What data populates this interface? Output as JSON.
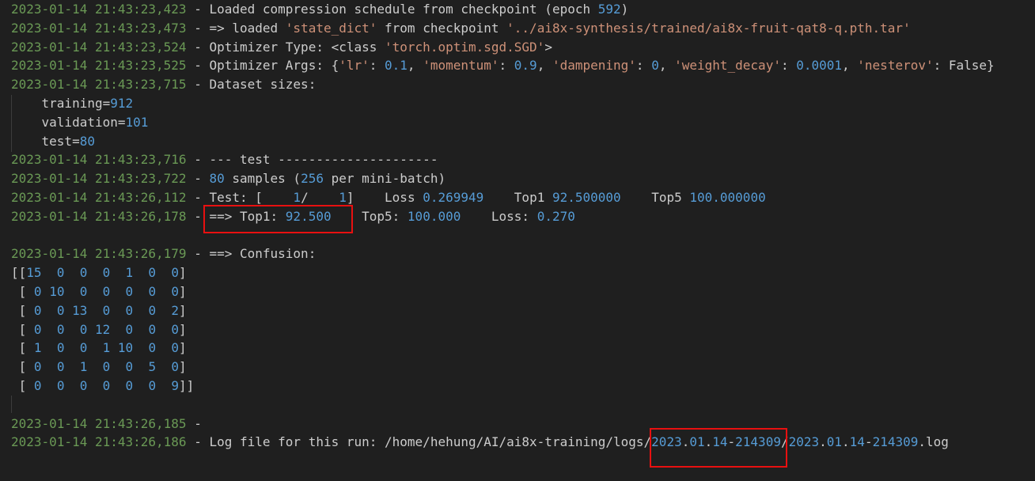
{
  "lines": [
    {
      "name": "log-line-1",
      "segs": [
        [
          "ts",
          "2023-01-14 21:43:23,423"
        ],
        [
          "txt",
          " - Loaded compression schedule from checkpoint (epoch "
        ],
        [
          "num",
          "592"
        ],
        [
          "txt",
          ")"
        ]
      ]
    },
    {
      "name": "log-line-2",
      "segs": [
        [
          "ts",
          "2023-01-14 21:43:23,473"
        ],
        [
          "txt",
          " - => loaded "
        ],
        [
          "str",
          "'state_dict'"
        ],
        [
          "txt",
          " from checkpoint "
        ],
        [
          "str",
          "'../ai8x-synthesis/trained/ai8x-fruit-qat8-q.pth.tar'"
        ]
      ]
    },
    {
      "name": "log-line-3",
      "segs": [
        [
          "ts",
          "2023-01-14 21:43:23,524"
        ],
        [
          "txt",
          " - Optimizer Type: <class "
        ],
        [
          "str",
          "'torch.optim.sgd.SGD'"
        ],
        [
          "txt",
          ">"
        ]
      ]
    },
    {
      "name": "log-line-4",
      "segs": [
        [
          "ts",
          "2023-01-14 21:43:23,525"
        ],
        [
          "txt",
          " - Optimizer Args: {"
        ],
        [
          "str",
          "'lr'"
        ],
        [
          "txt",
          ": "
        ],
        [
          "num",
          "0.1"
        ],
        [
          "txt",
          ", "
        ],
        [
          "str",
          "'momentum'"
        ],
        [
          "txt",
          ": "
        ],
        [
          "num",
          "0.9"
        ],
        [
          "txt",
          ", "
        ],
        [
          "str",
          "'dampening'"
        ],
        [
          "txt",
          ": "
        ],
        [
          "num",
          "0"
        ],
        [
          "txt",
          ", "
        ],
        [
          "str",
          "'weight_decay'"
        ],
        [
          "txt",
          ": "
        ],
        [
          "num",
          "0.0001"
        ],
        [
          "txt",
          ", "
        ],
        [
          "str",
          "'nesterov'"
        ],
        [
          "txt",
          ": False}"
        ]
      ]
    },
    {
      "name": "log-line-5",
      "segs": [
        [
          "ts",
          "2023-01-14 21:43:23,715"
        ],
        [
          "txt",
          " - Dataset sizes:"
        ]
      ]
    },
    {
      "name": "dataset-training",
      "segs": [
        [
          "txt",
          "    training="
        ],
        [
          "num",
          "912"
        ]
      ]
    },
    {
      "name": "dataset-validation",
      "segs": [
        [
          "txt",
          "    validation="
        ],
        [
          "num",
          "101"
        ]
      ]
    },
    {
      "name": "dataset-test",
      "segs": [
        [
          "txt",
          "    test="
        ],
        [
          "num",
          "80"
        ]
      ]
    },
    {
      "name": "log-line-6",
      "segs": [
        [
          "ts",
          "2023-01-14 21:43:23,716"
        ],
        [
          "txt",
          " - --- test ---------------------"
        ]
      ]
    },
    {
      "name": "log-line-7",
      "segs": [
        [
          "ts",
          "2023-01-14 21:43:23,722"
        ],
        [
          "txt",
          " - "
        ],
        [
          "num",
          "80"
        ],
        [
          "txt",
          " samples ("
        ],
        [
          "num",
          "256"
        ],
        [
          "txt",
          " per mini-batch)"
        ]
      ]
    },
    {
      "name": "log-line-8",
      "segs": [
        [
          "ts",
          "2023-01-14 21:43:26,112"
        ],
        [
          "txt",
          " - Test: [    "
        ],
        [
          "num",
          "1"
        ],
        [
          "txt",
          "/    "
        ],
        [
          "num",
          "1"
        ],
        [
          "txt",
          "]    Loss "
        ],
        [
          "num",
          "0.269949"
        ],
        [
          "txt",
          "    Top1 "
        ],
        [
          "num",
          "92.500000"
        ],
        [
          "txt",
          "    Top5 "
        ],
        [
          "num",
          "100.000000"
        ]
      ]
    },
    {
      "name": "log-line-9",
      "segs": [
        [
          "ts",
          "2023-01-14 21:43:26,178"
        ],
        [
          "txt",
          " - ==> Top1: "
        ],
        [
          "num",
          "92.500"
        ],
        [
          "txt",
          "    Top5: "
        ],
        [
          "num",
          "100.000"
        ],
        [
          "txt",
          "    Loss: "
        ],
        [
          "num",
          "0.270"
        ]
      ]
    },
    {
      "name": "blank-line-1",
      "segs": [
        [
          "txt",
          " "
        ]
      ]
    },
    {
      "name": "log-line-10",
      "segs": [
        [
          "ts",
          "2023-01-14 21:43:26,179"
        ],
        [
          "txt",
          " - ==> Confusion:"
        ]
      ]
    },
    {
      "name": "confusion-row-1",
      "segs": [
        [
          "txt",
          "[["
        ],
        [
          "num",
          "15"
        ],
        [
          "txt",
          "  "
        ],
        [
          "num",
          "0"
        ],
        [
          "txt",
          "  "
        ],
        [
          "num",
          "0"
        ],
        [
          "txt",
          "  "
        ],
        [
          "num",
          "0"
        ],
        [
          "txt",
          "  "
        ],
        [
          "num",
          "1"
        ],
        [
          "txt",
          "  "
        ],
        [
          "num",
          "0"
        ],
        [
          "txt",
          "  "
        ],
        [
          "num",
          "0"
        ],
        [
          "txt",
          "]"
        ]
      ]
    },
    {
      "name": "confusion-row-2",
      "segs": [
        [
          "txt",
          " [ "
        ],
        [
          "num",
          "0"
        ],
        [
          "txt",
          " "
        ],
        [
          "num",
          "10"
        ],
        [
          "txt",
          "  "
        ],
        [
          "num",
          "0"
        ],
        [
          "txt",
          "  "
        ],
        [
          "num",
          "0"
        ],
        [
          "txt",
          "  "
        ],
        [
          "num",
          "0"
        ],
        [
          "txt",
          "  "
        ],
        [
          "num",
          "0"
        ],
        [
          "txt",
          "  "
        ],
        [
          "num",
          "0"
        ],
        [
          "txt",
          "]"
        ]
      ]
    },
    {
      "name": "confusion-row-3",
      "segs": [
        [
          "txt",
          " [ "
        ],
        [
          "num",
          "0"
        ],
        [
          "txt",
          "  "
        ],
        [
          "num",
          "0"
        ],
        [
          "txt",
          " "
        ],
        [
          "num",
          "13"
        ],
        [
          "txt",
          "  "
        ],
        [
          "num",
          "0"
        ],
        [
          "txt",
          "  "
        ],
        [
          "num",
          "0"
        ],
        [
          "txt",
          "  "
        ],
        [
          "num",
          "0"
        ],
        [
          "txt",
          "  "
        ],
        [
          "num",
          "2"
        ],
        [
          "txt",
          "]"
        ]
      ]
    },
    {
      "name": "confusion-row-4",
      "segs": [
        [
          "txt",
          " [ "
        ],
        [
          "num",
          "0"
        ],
        [
          "txt",
          "  "
        ],
        [
          "num",
          "0"
        ],
        [
          "txt",
          "  "
        ],
        [
          "num",
          "0"
        ],
        [
          "txt",
          " "
        ],
        [
          "num",
          "12"
        ],
        [
          "txt",
          "  "
        ],
        [
          "num",
          "0"
        ],
        [
          "txt",
          "  "
        ],
        [
          "num",
          "0"
        ],
        [
          "txt",
          "  "
        ],
        [
          "num",
          "0"
        ],
        [
          "txt",
          "]"
        ]
      ]
    },
    {
      "name": "confusion-row-5",
      "segs": [
        [
          "txt",
          " [ "
        ],
        [
          "num",
          "1"
        ],
        [
          "txt",
          "  "
        ],
        [
          "num",
          "0"
        ],
        [
          "txt",
          "  "
        ],
        [
          "num",
          "0"
        ],
        [
          "txt",
          "  "
        ],
        [
          "num",
          "1"
        ],
        [
          "txt",
          " "
        ],
        [
          "num",
          "10"
        ],
        [
          "txt",
          "  "
        ],
        [
          "num",
          "0"
        ],
        [
          "txt",
          "  "
        ],
        [
          "num",
          "0"
        ],
        [
          "txt",
          "]"
        ]
      ]
    },
    {
      "name": "confusion-row-6",
      "segs": [
        [
          "txt",
          " [ "
        ],
        [
          "num",
          "0"
        ],
        [
          "txt",
          "  "
        ],
        [
          "num",
          "0"
        ],
        [
          "txt",
          "  "
        ],
        [
          "num",
          "1"
        ],
        [
          "txt",
          "  "
        ],
        [
          "num",
          "0"
        ],
        [
          "txt",
          "  "
        ],
        [
          "num",
          "0"
        ],
        [
          "txt",
          "  "
        ],
        [
          "num",
          "5"
        ],
        [
          "txt",
          "  "
        ],
        [
          "num",
          "0"
        ],
        [
          "txt",
          "]"
        ]
      ]
    },
    {
      "name": "confusion-row-7",
      "segs": [
        [
          "txt",
          " [ "
        ],
        [
          "num",
          "0"
        ],
        [
          "txt",
          "  "
        ],
        [
          "num",
          "0"
        ],
        [
          "txt",
          "  "
        ],
        [
          "num",
          "0"
        ],
        [
          "txt",
          "  "
        ],
        [
          "num",
          "0"
        ],
        [
          "txt",
          "  "
        ],
        [
          "num",
          "0"
        ],
        [
          "txt",
          "  "
        ],
        [
          "num",
          "0"
        ],
        [
          "txt",
          "  "
        ],
        [
          "num",
          "9"
        ],
        [
          "txt",
          "]]"
        ]
      ]
    },
    {
      "name": "blank-line-2",
      "segs": [
        [
          "txt",
          " "
        ]
      ]
    },
    {
      "name": "log-line-11",
      "segs": [
        [
          "ts",
          "2023-01-14 21:43:26,185"
        ],
        [
          "txt",
          " -"
        ]
      ]
    },
    {
      "name": "log-line-12",
      "segs": [
        [
          "ts",
          "2023-01-14 21:43:26,186"
        ],
        [
          "txt",
          " - Log file for this run: /home/hehung/AI/ai8x-training/logs/"
        ],
        [
          "num",
          "2023"
        ],
        [
          "txt",
          "."
        ],
        [
          "num",
          "01"
        ],
        [
          "txt",
          "."
        ],
        [
          "num",
          "14"
        ],
        [
          "txt",
          "-"
        ],
        [
          "num",
          "214309"
        ],
        [
          "txt",
          "/"
        ],
        [
          "num",
          "2023"
        ],
        [
          "txt",
          "."
        ],
        [
          "num",
          "01"
        ],
        [
          "txt",
          "."
        ],
        [
          "num",
          "14"
        ],
        [
          "txt",
          "-"
        ],
        [
          "num",
          "214309"
        ],
        [
          "txt",
          ".log"
        ]
      ]
    }
  ],
  "colors": {
    "background": "#1f1f1f",
    "timestamp": "#6a9955",
    "text": "#cccccc",
    "number": "#569cd6",
    "string": "#ce9178",
    "highlight_box": "#e81010"
  }
}
